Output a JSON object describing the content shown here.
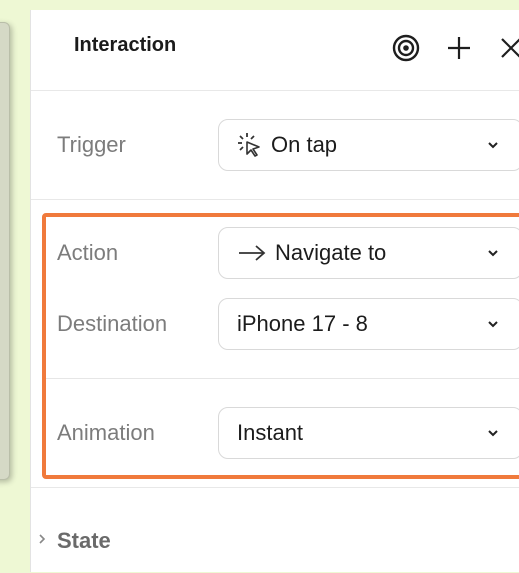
{
  "panel": {
    "title": "Interaction",
    "header_icons": [
      "target-icon",
      "plus-icon",
      "close-icon"
    ]
  },
  "trigger": {
    "label": "Trigger",
    "value": "On tap",
    "icon": "tap-cursor-icon"
  },
  "action": {
    "label": "Action",
    "value": "Navigate to",
    "icon": "arrow-right-icon"
  },
  "destination": {
    "label": "Destination",
    "value": "iPhone 17 - 8"
  },
  "animation": {
    "label": "Animation",
    "value": "Instant"
  },
  "state": {
    "label": "State"
  },
  "colors": {
    "highlight": "#f07a3c",
    "background": "#eef8d4",
    "label_text": "#7c7c7c"
  }
}
